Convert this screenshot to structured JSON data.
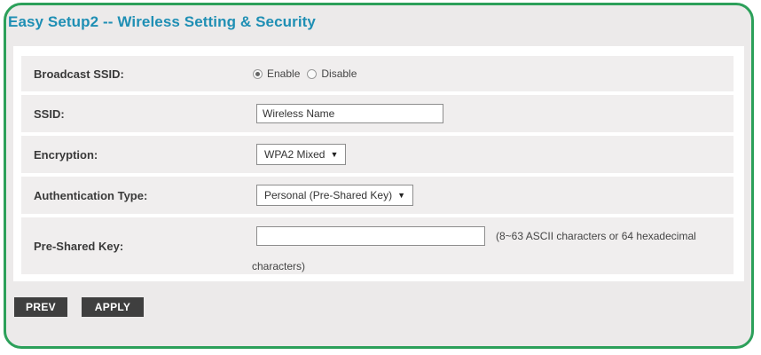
{
  "page": {
    "title": "Easy Setup2 -- Wireless Setting & Security"
  },
  "form": {
    "broadcast_ssid": {
      "label": "Broadcast SSID:",
      "options": [
        "Enable",
        "Disable"
      ],
      "selected": "Enable"
    },
    "ssid": {
      "label": "SSID:",
      "value": "Wireless Name"
    },
    "encryption": {
      "label": "Encryption:",
      "selected": "WPA2 Mixed"
    },
    "authentication_type": {
      "label": "Authentication Type:",
      "selected": "Personal (Pre-Shared Key)"
    },
    "pre_shared_key": {
      "label": "Pre-Shared Key:",
      "value": "",
      "hint_part1": "(8~63 ASCII characters or 64 hexadecimal",
      "hint_part2": "characters)"
    }
  },
  "buttons": {
    "prev": "PREV",
    "apply": "APPLY"
  },
  "colors": {
    "frame_border": "#2ca05a",
    "title": "#1f8fb4",
    "button_bg": "#3f3f3f"
  },
  "icons": {
    "dropdown_caret": "▼"
  }
}
